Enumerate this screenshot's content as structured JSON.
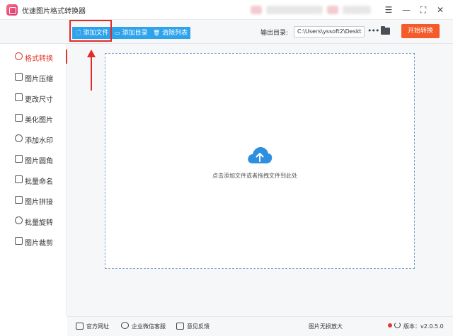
{
  "app": {
    "title": "优速图片格式转换器"
  },
  "window_controls": {
    "menu": "☰",
    "minimize": "—",
    "maximize": "⛶",
    "close": "✕"
  },
  "toolbar": {
    "add_file": "添加文件",
    "add_folder": "添加目录",
    "clear_list": "清除列表",
    "output_label": "输出目录:",
    "output_path": "C:\\Users\\yssoft2\\Deskt",
    "more": "•••",
    "start": "开始转换"
  },
  "sidebar": {
    "items": [
      {
        "label": "格式转换",
        "icon": "format-convert-icon",
        "active": true
      },
      {
        "label": "图片压缩",
        "icon": "compress-icon",
        "active": false
      },
      {
        "label": "更改尺寸",
        "icon": "resize-icon",
        "active": false
      },
      {
        "label": "美化图片",
        "icon": "beautify-icon",
        "active": false
      },
      {
        "label": "添加水印",
        "icon": "watermark-icon",
        "active": false
      },
      {
        "label": "图片圆角",
        "icon": "round-corner-icon",
        "active": false
      },
      {
        "label": "批量命名",
        "icon": "rename-icon",
        "active": false
      },
      {
        "label": "图片拼接",
        "icon": "stitch-icon",
        "active": false
      },
      {
        "label": "批量旋转",
        "icon": "rotate-icon",
        "active": false
      },
      {
        "label": "图片裁剪",
        "icon": "crop-icon",
        "active": false
      }
    ]
  },
  "dropzone": {
    "hint": "点击添加文件或者拖拽文件到此处"
  },
  "footer": {
    "website": "官方网址",
    "wechat": "企业微信客服",
    "feedback": "意见反馈",
    "lossless": "图片无损放大",
    "version": "版本：v2.0.5.0"
  },
  "colors": {
    "accent_blue": "#2ea3ec",
    "start_orange": "#f45a2a",
    "active_red": "#e0382c"
  }
}
